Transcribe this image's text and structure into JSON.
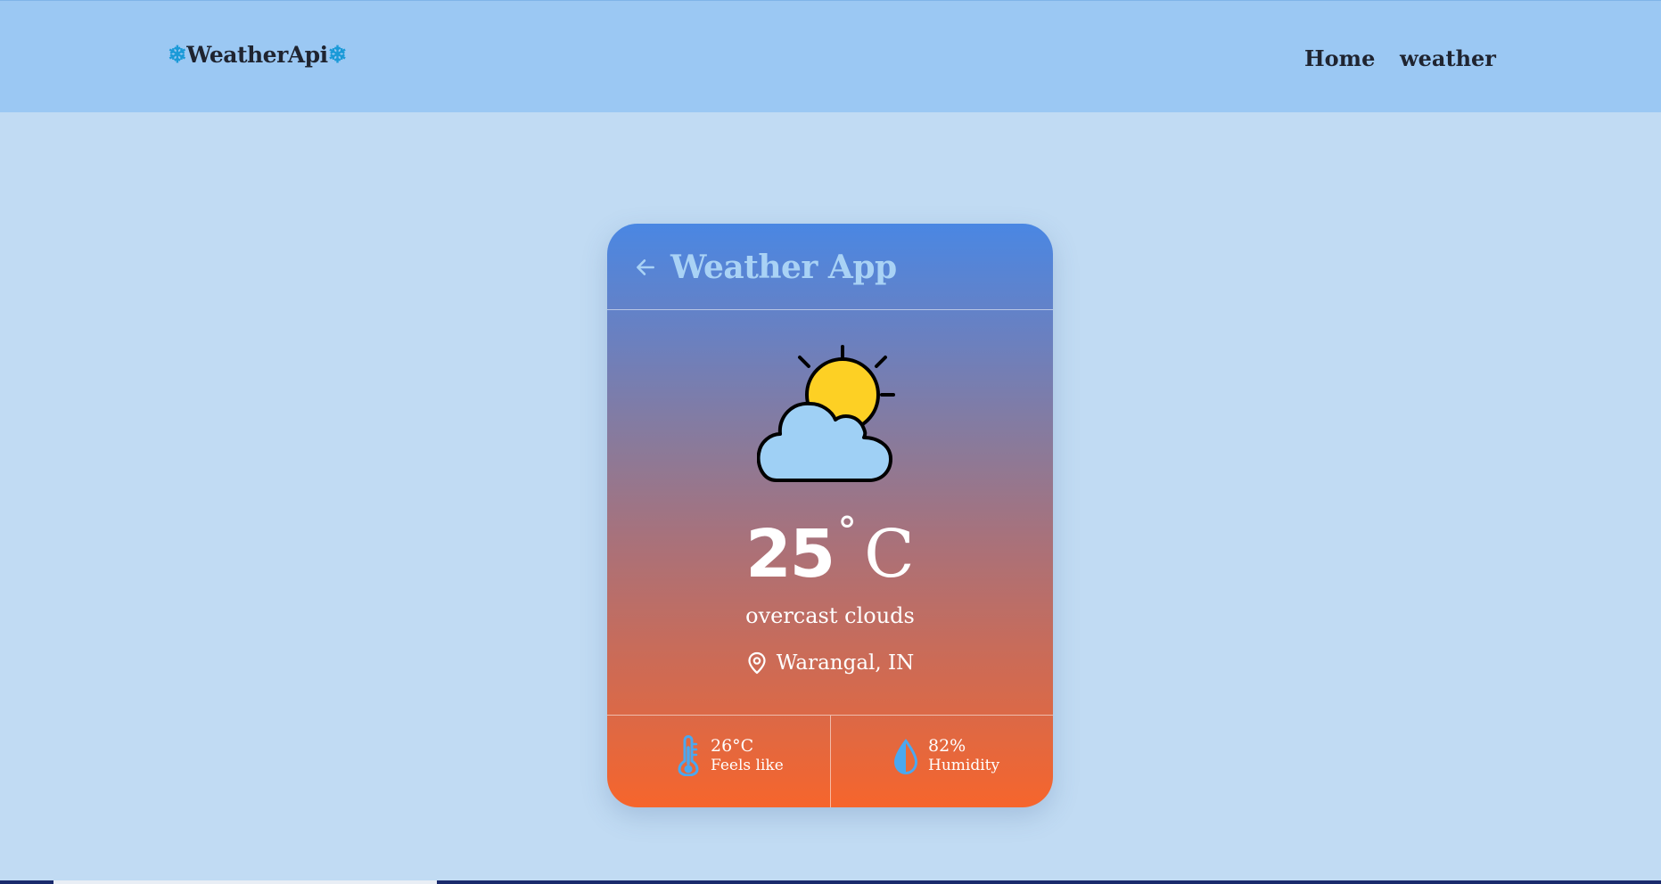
{
  "navbar": {
    "brand": "WeatherApi",
    "brand_icon": "snowflake-icon",
    "links": [
      "Home",
      "weather"
    ]
  },
  "card": {
    "title": "Weather App",
    "icons": {
      "back": "arrow-left-icon",
      "weather": "partly-cloudy-icon",
      "location": "map-pin-icon",
      "feels_like": "thermometer-icon",
      "humidity": "water-drop-icon"
    },
    "temperature": "25",
    "degree_symbol": "°",
    "unit": "C",
    "description": "overcast clouds",
    "location": "Warangal, IN",
    "feels_like": {
      "value": "26°C",
      "label": "Feels like"
    },
    "humidity": {
      "value": "82%",
      "label": "Humidity"
    }
  },
  "colors": {
    "navbar": "#9bc8f3",
    "page_background": "#c1dbf3",
    "card_gradient_top": "#4a87e3",
    "card_gradient_bottom": "#f6652c",
    "title": "#a9d2f5",
    "icon_accent": "#4aa8f0"
  }
}
